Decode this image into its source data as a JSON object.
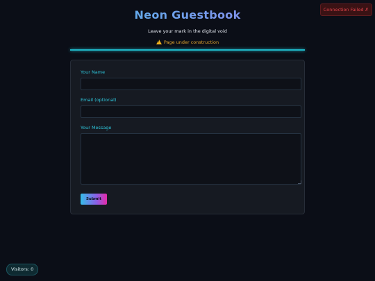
{
  "status": {
    "connection": "Connection Failed ✗"
  },
  "header": {
    "title": "Neon Guestbook",
    "subtitle": "Leave your mark in the digital void",
    "notice": "Page under construction",
    "notice_icon": "warning-icon"
  },
  "form": {
    "name_label": "Your Name",
    "name_value": "",
    "email_label": "Email (optional)",
    "email_value": "",
    "message_label": "Your Message",
    "message_value": "",
    "submit_label": "Submit"
  },
  "footer": {
    "visitors": "Visitors: 0"
  },
  "colors": {
    "background": "#0b0e17",
    "accent_cyan": "#1fb6c7",
    "warning": "#e0a32c",
    "error": "#e2434b"
  }
}
